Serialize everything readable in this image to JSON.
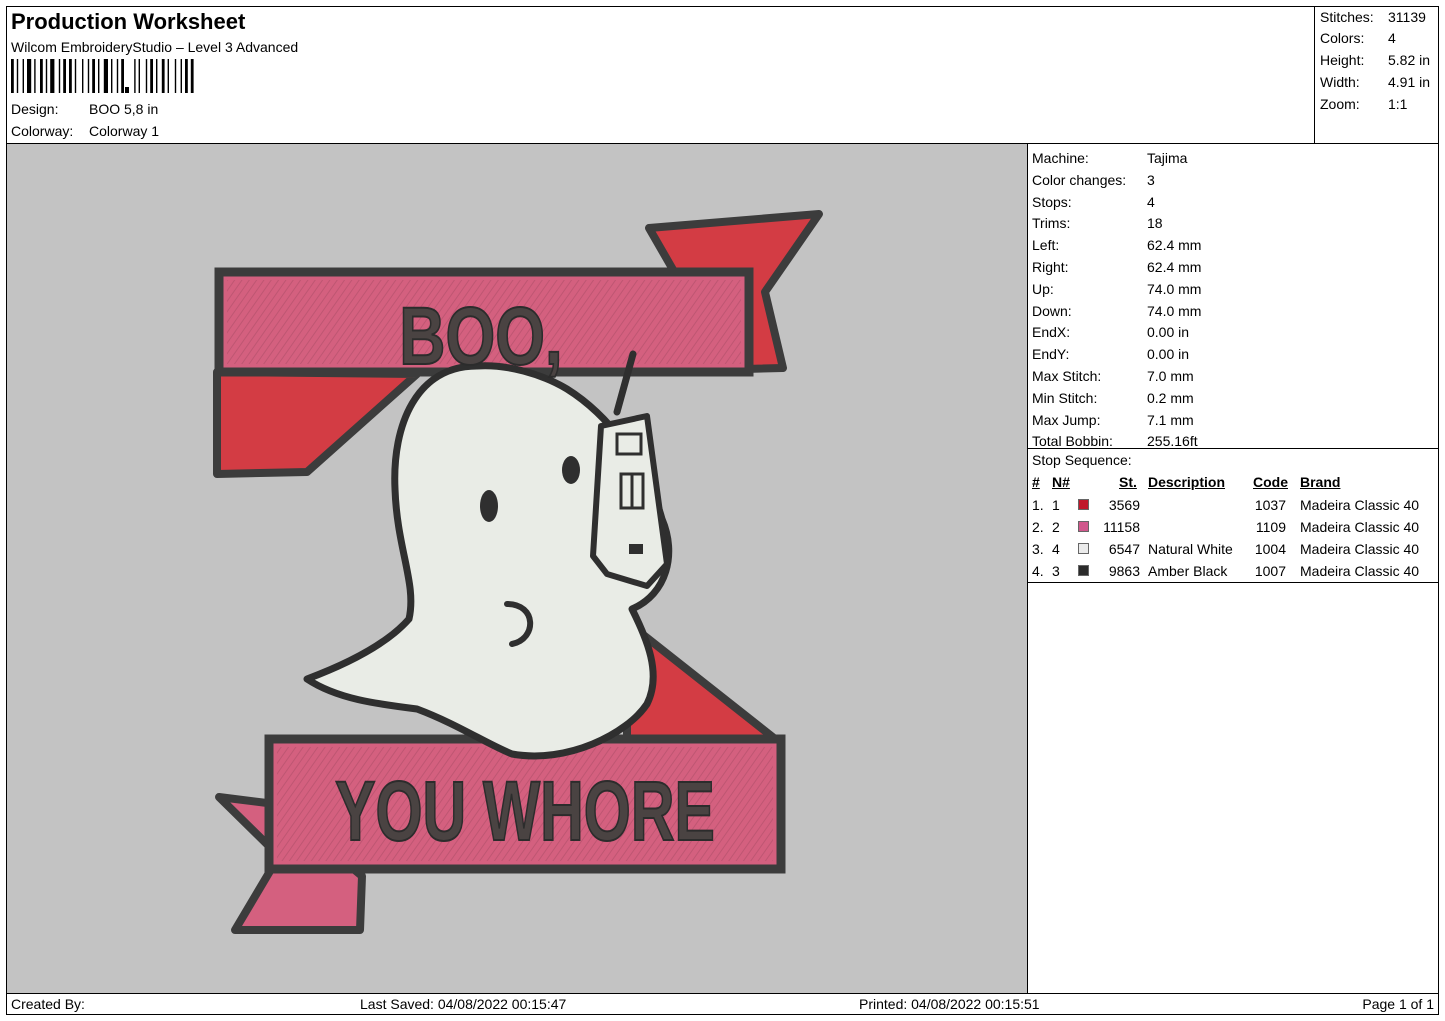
{
  "header": {
    "title": "Production Worksheet",
    "app": "Wilcom EmbroideryStudio – Level 3 Advanced",
    "design_label": "Design:",
    "design_value": "BOO 5,8 in",
    "colorway_label": "Colorway:",
    "colorway_value": "Colorway 1"
  },
  "stats": [
    {
      "label": "Stitches:",
      "value": "31139"
    },
    {
      "label": "Colors:",
      "value": "4"
    },
    {
      "label": "Height:",
      "value": "5.82 in"
    },
    {
      "label": "Width:",
      "value": "4.91 in"
    },
    {
      "label": "Zoom:",
      "value": "1:1"
    }
  ],
  "design_text": {
    "line1": "BOO,",
    "line2": "YOU WHORE"
  },
  "info": [
    {
      "label": "Machine:",
      "value": "Tajima"
    },
    {
      "label": "Color changes:",
      "value": "3"
    },
    {
      "label": "Stops:",
      "value": "4"
    },
    {
      "label": "Trims:",
      "value": "18"
    },
    {
      "label": "Left:",
      "value": "62.4 mm"
    },
    {
      "label": "Right:",
      "value": "62.4 mm"
    },
    {
      "label": "Up:",
      "value": "74.0 mm"
    },
    {
      "label": "Down:",
      "value": "74.0 mm"
    },
    {
      "label": "EndX:",
      "value": "0.00 in"
    },
    {
      "label": "EndY:",
      "value": "0.00 in"
    },
    {
      "label": "Max Stitch:",
      "value": "7.0 mm"
    },
    {
      "label": "Min Stitch:",
      "value": "0.2 mm"
    },
    {
      "label": "Max Jump:",
      "value": "7.1 mm"
    },
    {
      "label": "Total Bobbin:",
      "value": "255.16ft"
    }
  ],
  "stop_sequence": {
    "title": "Stop Sequence:",
    "headers": {
      "seq": "#",
      "n": "N#",
      "st": "St.",
      "desc": "Description",
      "code": "Code",
      "brand": "Brand"
    },
    "rows": [
      {
        "seq": "1.",
        "n": "1",
        "color": "#c0192c",
        "st": "3569",
        "desc": "",
        "code": "1037",
        "brand": "Madeira Classic 40"
      },
      {
        "seq": "2.",
        "n": "2",
        "color": "#d0588c",
        "st": "11158",
        "desc": "",
        "code": "1109",
        "brand": "Madeira Classic 40"
      },
      {
        "seq": "3.",
        "n": "4",
        "color": "#ebebeb",
        "st": "6547",
        "desc": "Natural White",
        "code": "1004",
        "brand": "Madeira Classic 40"
      },
      {
        "seq": "4.",
        "n": "3",
        "color": "#2b2b2b",
        "st": "9863",
        "desc": "Amber Black",
        "code": "1007",
        "brand": "Madeira Classic 40"
      }
    ]
  },
  "footer": {
    "created_by": "Created By:",
    "last_saved": "Last Saved: 04/08/2022 00:15:47",
    "printed": "Printed: 04/08/2022 00:15:51",
    "page": "Page 1 of 1"
  },
  "colors": {
    "preview_bg": "#c3c3c3",
    "banner_pink": "#d4607f",
    "fold_red": "#d33c44",
    "outline": "#3c3c3c",
    "ghost": "#e9ece6"
  }
}
